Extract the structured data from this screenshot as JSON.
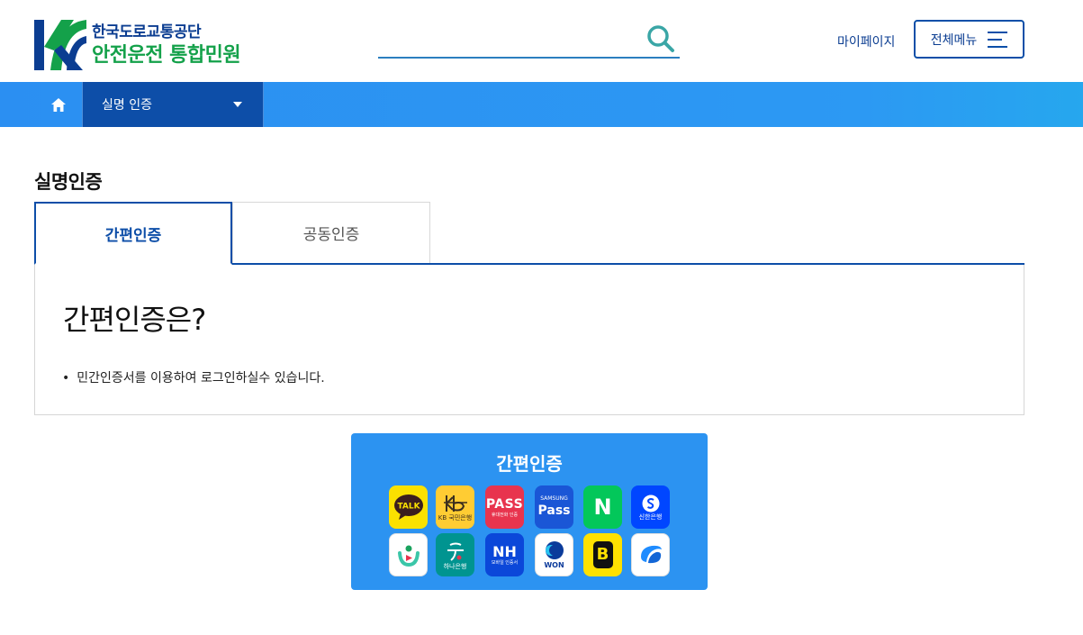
{
  "header": {
    "org_name": "한국도로교통공단",
    "service_name": "안전운전 통합민원",
    "search_placeholder": "",
    "mypage_label": "마이페이지",
    "allmenu_label": "전체메뉴"
  },
  "nav": {
    "current_menu": "실명 인증"
  },
  "page": {
    "title": "실명인증",
    "tabs": [
      {
        "label": "간편인증",
        "active": true
      },
      {
        "label": "공동인증",
        "active": false
      }
    ],
    "info_title": "간편인증은?",
    "info_bullet": "민간인증서를 이용하여 로그인하실수 있습니다."
  },
  "easy_auth": {
    "title": "간편인증",
    "apps": [
      {
        "icon": "kakaotalk-icon",
        "text": "TALK",
        "bg": "#fae100"
      },
      {
        "icon": "kb-bank-icon",
        "text": "KB 국민은행",
        "bg": "#ffcc33"
      },
      {
        "icon": "pass-icon",
        "text": "PASS",
        "sub": "휴대전화 인증",
        "bg": "#e8344e"
      },
      {
        "icon": "samsung-pass-icon",
        "text": "Pass",
        "sub": "SAMSUNG",
        "bg": "#1a56d6"
      },
      {
        "icon": "naver-icon",
        "text": "N",
        "bg": "#03c75a"
      },
      {
        "icon": "shinhan-bank-icon",
        "text": "신한은행",
        "bg": "#0046ff"
      },
      {
        "icon": "toss-cert-icon",
        "text": "",
        "bg": "#ffffff"
      },
      {
        "icon": "hana-bank-icon",
        "text": "하나은행",
        "bg": "#009490"
      },
      {
        "icon": "nh-bank-icon",
        "text": "NH",
        "sub": "모바일 인증서",
        "bg": "#0b47d9"
      },
      {
        "icon": "woori-won-icon",
        "text": "WON",
        "bg": "#ffffff"
      },
      {
        "icon": "banksalad-icon",
        "text": "B",
        "bg": "#ffe100"
      },
      {
        "icon": "toss-icon",
        "text": "",
        "bg": "#ffffff"
      }
    ]
  },
  "colors": {
    "primary": "#0d4ea8",
    "navbar": "#2b8ff2",
    "logo_green": "#14a14a",
    "panel": "#2c93f1"
  }
}
